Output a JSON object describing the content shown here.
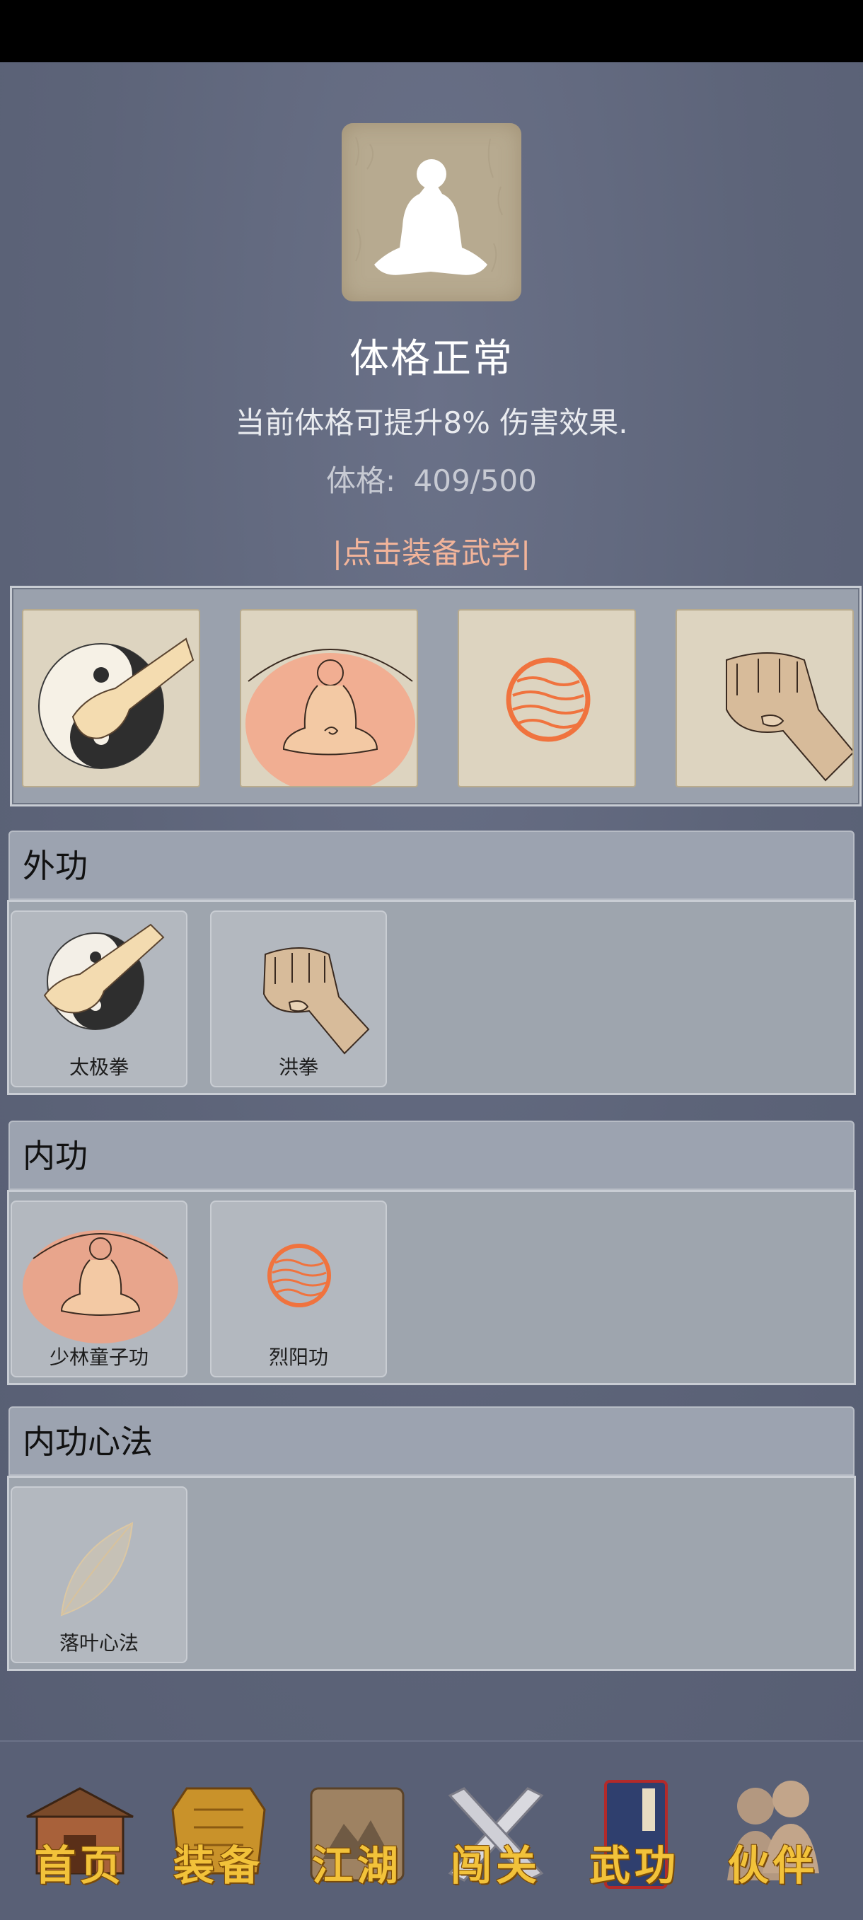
{
  "status": {
    "title": "体格正常",
    "description": "当前体格可提升8% 伤害效果.",
    "physique_label": "体格:",
    "physique_value": "409/500",
    "equip_hint": "|点击装备武学|"
  },
  "equipped_slots": [
    {
      "icon": "taiji-fist-icon"
    },
    {
      "icon": "meditation-aura-icon"
    },
    {
      "icon": "sun-orb-icon"
    },
    {
      "icon": "fist-icon"
    }
  ],
  "sections": [
    {
      "title": "外功",
      "items": [
        {
          "label": "太极拳",
          "icon": "taiji-fist-icon"
        },
        {
          "label": "洪拳",
          "icon": "fist-icon"
        }
      ]
    },
    {
      "title": "内功",
      "items": [
        {
          "label": "少林童子功",
          "icon": "meditation-aura-icon"
        },
        {
          "label": "烈阳功",
          "icon": "sun-orb-icon"
        }
      ]
    },
    {
      "title": "内功心法",
      "items": [
        {
          "label": "落叶心法",
          "icon": "leaf-icon"
        }
      ]
    }
  ],
  "nav": [
    {
      "label": "首页",
      "icon": "house-icon"
    },
    {
      "label": "装备",
      "icon": "armor-icon"
    },
    {
      "label": "江湖",
      "icon": "scroll-map-icon"
    },
    {
      "label": "闯关",
      "icon": "crossed-swords-icon"
    },
    {
      "label": "武功",
      "icon": "book-icon"
    },
    {
      "label": "伙伴",
      "icon": "companions-icon"
    }
  ],
  "colors": {
    "accent_hint": "#f2b49a",
    "nav_text": "#f2c23a",
    "background": "#5b6277"
  }
}
